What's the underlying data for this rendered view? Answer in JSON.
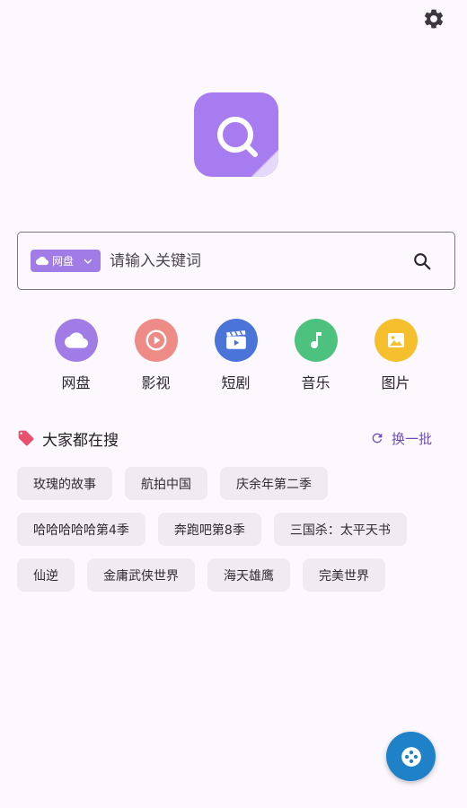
{
  "header": {
    "settings_icon": "gear-icon"
  },
  "logo": {
    "icon": "search-icon",
    "color": "#a67cf0"
  },
  "search": {
    "scope_label": "网盘",
    "placeholder": "请输入关键词",
    "value": "",
    "accent": "#a27ce6"
  },
  "categories": [
    {
      "label": "网盘",
      "icon": "cloud-icon",
      "color": "#a27ce6"
    },
    {
      "label": "影视",
      "icon": "play-icon",
      "color": "#ef8b86"
    },
    {
      "label": "短剧",
      "icon": "clapperboard-icon",
      "color": "#4b74d9"
    },
    {
      "label": "音乐",
      "icon": "music-note-icon",
      "color": "#4cc27e"
    },
    {
      "label": "图片",
      "icon": "image-icon",
      "color": "#f5bf2e"
    }
  ],
  "hot": {
    "title": "大家都在搜",
    "refresh_label": "换一批",
    "tags": [
      "玫瑰的故事",
      "航拍中国",
      "庆余年第二季",
      "哈哈哈哈哈第4季",
      "奔跑吧第8季",
      "三国杀：太平天书",
      "仙逆",
      "金庸武侠世界",
      "海天雄鹰",
      "完美世界"
    ]
  },
  "fab": {
    "icon": "game-controller-icon",
    "color": "#1f82c9"
  }
}
